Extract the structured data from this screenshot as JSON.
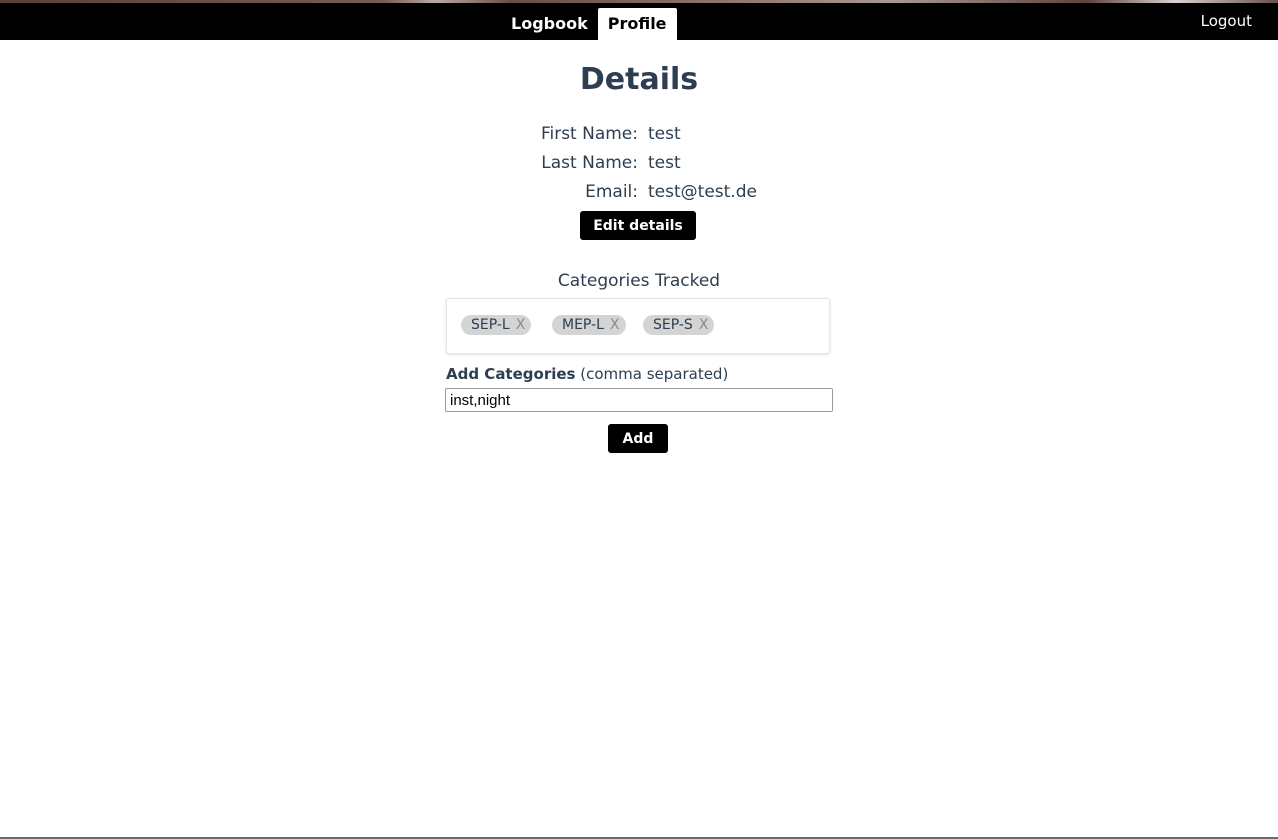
{
  "nav": {
    "tabs": [
      {
        "label": "Logbook",
        "active": false
      },
      {
        "label": "Profile",
        "active": true
      }
    ],
    "logout_label": "Logout"
  },
  "details": {
    "title": "Details",
    "fields": [
      {
        "label": "First Name:",
        "value": "test"
      },
      {
        "label": "Last Name:",
        "value": "test"
      },
      {
        "label": "Email:",
        "value": "test@test.de"
      }
    ],
    "edit_label": "Edit details"
  },
  "categories": {
    "heading": "Categories Tracked",
    "chips": [
      {
        "label": "SEP-L",
        "remove": "X"
      },
      {
        "label": "MEP-L",
        "remove": "X"
      },
      {
        "label": "SEP-S",
        "remove": "X"
      }
    ],
    "add_label": "Add Categories",
    "add_hint": "(comma separated)",
    "input_value": "inst,night",
    "add_button_label": "Add"
  },
  "colors": {
    "nav_bg": "#000000",
    "text": "#2c3e50",
    "chip_bg": "#d4d4d4",
    "button_bg": "#000000"
  }
}
